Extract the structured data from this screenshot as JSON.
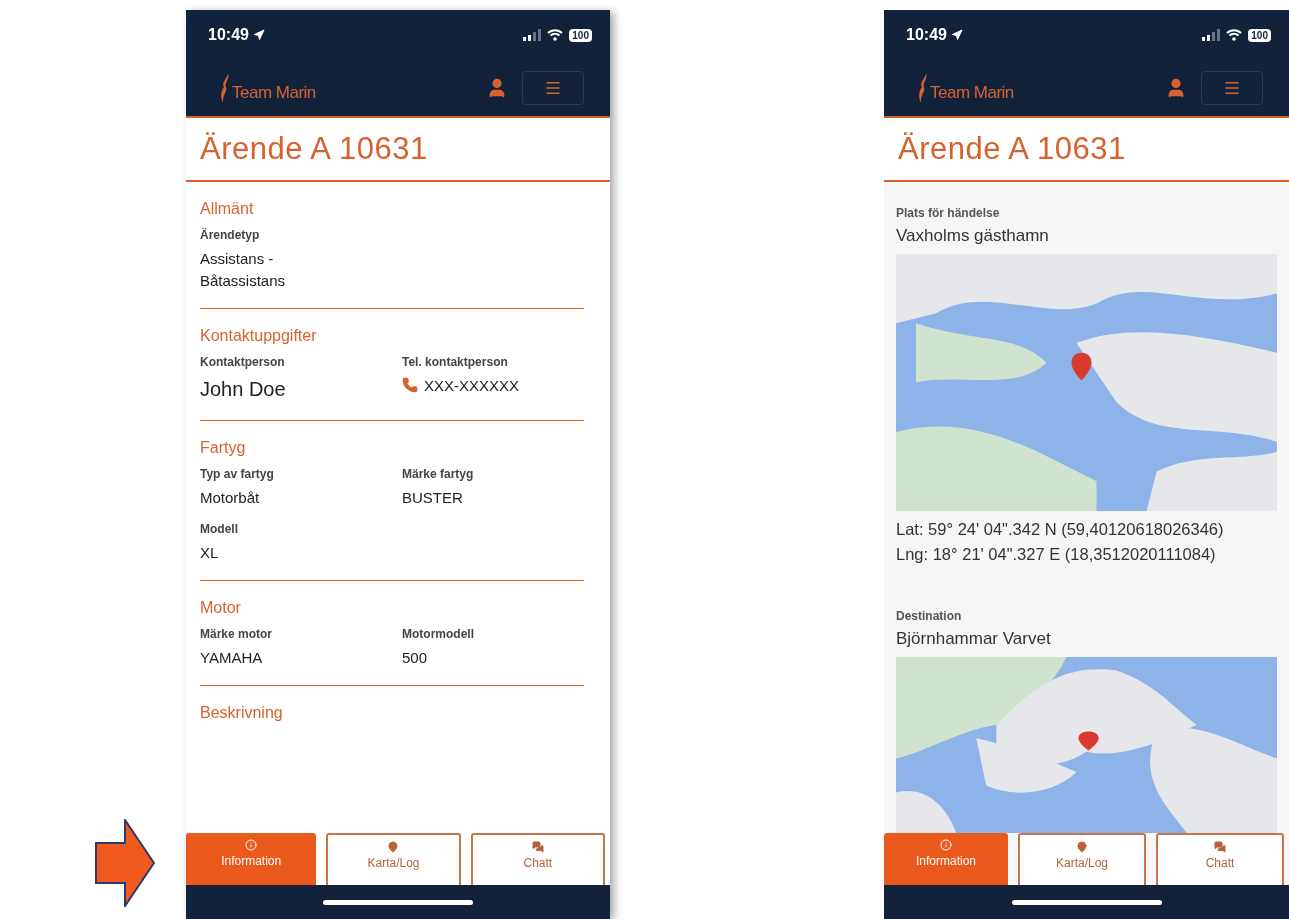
{
  "screens": [
    {
      "kind": "info",
      "status": {
        "time": "10:49",
        "battery": "100"
      },
      "logo": "Team Marin",
      "title": "Ärende A 10631",
      "sections": [
        {
          "heading": "Allmänt",
          "fields": [
            {
              "label": "Ärendetyp",
              "value": "Assistans - Båtassistans",
              "kind": "text"
            }
          ]
        },
        {
          "heading": "Kontaktuppgifter",
          "fields": [
            {
              "label": "Kontaktperson",
              "value": "John Doe",
              "kind": "large"
            },
            {
              "label": "Tel. kontaktperson",
              "value": "XXX-XXXXXX",
              "kind": "phone"
            }
          ]
        },
        {
          "heading": "Fartyg",
          "fields": [
            {
              "label": "Typ av fartyg",
              "value": "Motorbåt",
              "kind": "text"
            },
            {
              "label": "Märke fartyg",
              "value": "BUSTER",
              "kind": "text"
            },
            {
              "label": "Modell",
              "value": "XL",
              "kind": "text"
            }
          ]
        },
        {
          "heading": "Motor",
          "fields": [
            {
              "label": "Märke motor",
              "value": "YAMAHA",
              "kind": "text"
            },
            {
              "label": "Motormodell",
              "value": "500",
              "kind": "text"
            }
          ]
        },
        {
          "heading": "Beskrivning"
        }
      ],
      "tabs": [
        {
          "label": "Information",
          "kind": "info",
          "selected": true
        },
        {
          "label": "Karta/Log",
          "kind": "pin",
          "selected": false
        },
        {
          "label": "Chatt",
          "kind": "chat",
          "selected": false
        }
      ]
    },
    {
      "kind": "map",
      "status": {
        "time": "10:49",
        "battery": "100"
      },
      "logo": "Team Marin",
      "title": "Ärende A 10631",
      "places": [
        {
          "label": "Plats för händelse",
          "name": "Vaxholms gästhamn",
          "coords": [
            "Lat: 59° 24' 04\".342 N (59,40120618026346)",
            "Lng: 18° 21' 04\".327 E (18,3512020111084)"
          ]
        },
        {
          "label": "Destination",
          "name": "Björnhammar Varvet"
        }
      ],
      "tabs": [
        {
          "label": "Information",
          "kind": "info",
          "selected": true
        },
        {
          "label": "Karta/Log",
          "kind": "pin",
          "selected": false
        },
        {
          "label": "Chatt",
          "kind": "chat",
          "selected": false
        }
      ]
    }
  ]
}
